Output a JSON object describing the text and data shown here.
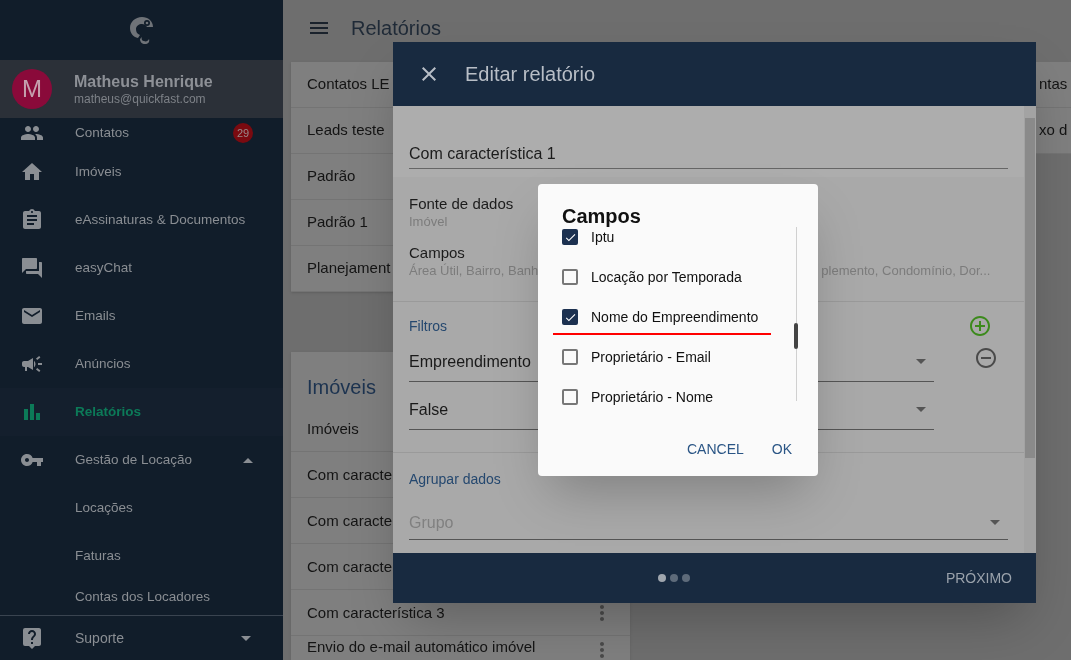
{
  "sidebar": {
    "user": {
      "initial": "M",
      "name": "Matheus Henrique",
      "email": "matheus@quickfast.com"
    },
    "items": [
      {
        "kind": "main",
        "label": "Contatos",
        "badge": "29",
        "selected": false
      },
      {
        "kind": "main",
        "label": "Imóveis",
        "selected": false
      },
      {
        "kind": "main",
        "label": "eAssinaturas & Documentos",
        "selected": false
      },
      {
        "kind": "main",
        "label": "easyChat",
        "selected": false
      },
      {
        "kind": "main",
        "label": "Emails",
        "selected": false
      },
      {
        "kind": "main",
        "label": "Anúncios",
        "selected": false
      },
      {
        "kind": "main",
        "label": "Relatórios",
        "selected": true
      },
      {
        "kind": "group",
        "label": "Gestão de Locação",
        "expanded": true,
        "selected": false
      },
      {
        "kind": "sub",
        "label": "Locações",
        "selected": false
      },
      {
        "kind": "sub",
        "label": "Faturas",
        "selected": false
      },
      {
        "kind": "sub",
        "label": "Contas dos Locadores",
        "selected": false
      }
    ],
    "footer": {
      "label": "Suporte",
      "expanded": false
    }
  },
  "page": {
    "title": "Relatórios",
    "list_1": [
      "Contatos LE",
      "Leads teste",
      "Padrão",
      "Padrão 1",
      "Planejament"
    ],
    "list_2": {
      "title": "Imóveis",
      "rows": [
        {
          "label": "Imóveis",
          "menu": false
        },
        {
          "label": "Com caracte",
          "menu": false
        },
        {
          "label": "Com caracte",
          "menu": false
        },
        {
          "label": "Com caracte",
          "menu": false
        },
        {
          "label": "Com característica 3",
          "menu": true
        },
        {
          "label": "Envio do e-mail automático imóvel",
          "menu": true
        }
      ]
    },
    "list_3": [
      "ntas",
      "xo d"
    ]
  },
  "edit_dialog": {
    "title": "Editar relatório",
    "name": "Com característica 1",
    "source": {
      "label": "Fonte de dados",
      "value": "Imóvel"
    },
    "fields": {
      "label": "Campos",
      "value_start": "Área Útil, Bairro, Banh",
      "value_end": "plemento, Condomínio, Dor..."
    },
    "filters": {
      "title": "Filtros",
      "selects": [
        "Empreendimento",
        "False"
      ]
    },
    "group": {
      "title": "Agrupar dados",
      "placeholder": "Grupo"
    },
    "steps": [
      {
        "selected": true
      },
      {
        "selected": false
      },
      {
        "selected": false
      }
    ],
    "next": "PRÓXIMO"
  },
  "fields_dialog": {
    "title": "Campos",
    "options": [
      {
        "label": "Iptu",
        "checked": true,
        "highlighted": false
      },
      {
        "label": "Locação por Temporada",
        "checked": false,
        "highlighted": false
      },
      {
        "label": "Nome do Empreendimento",
        "checked": true,
        "highlighted": true
      },
      {
        "label": "Proprietário - Email",
        "checked": false,
        "highlighted": false
      },
      {
        "label": "Proprietário - Nome",
        "checked": false,
        "highlighted": false
      }
    ],
    "buttons": [
      "CANCEL",
      "OK"
    ]
  }
}
